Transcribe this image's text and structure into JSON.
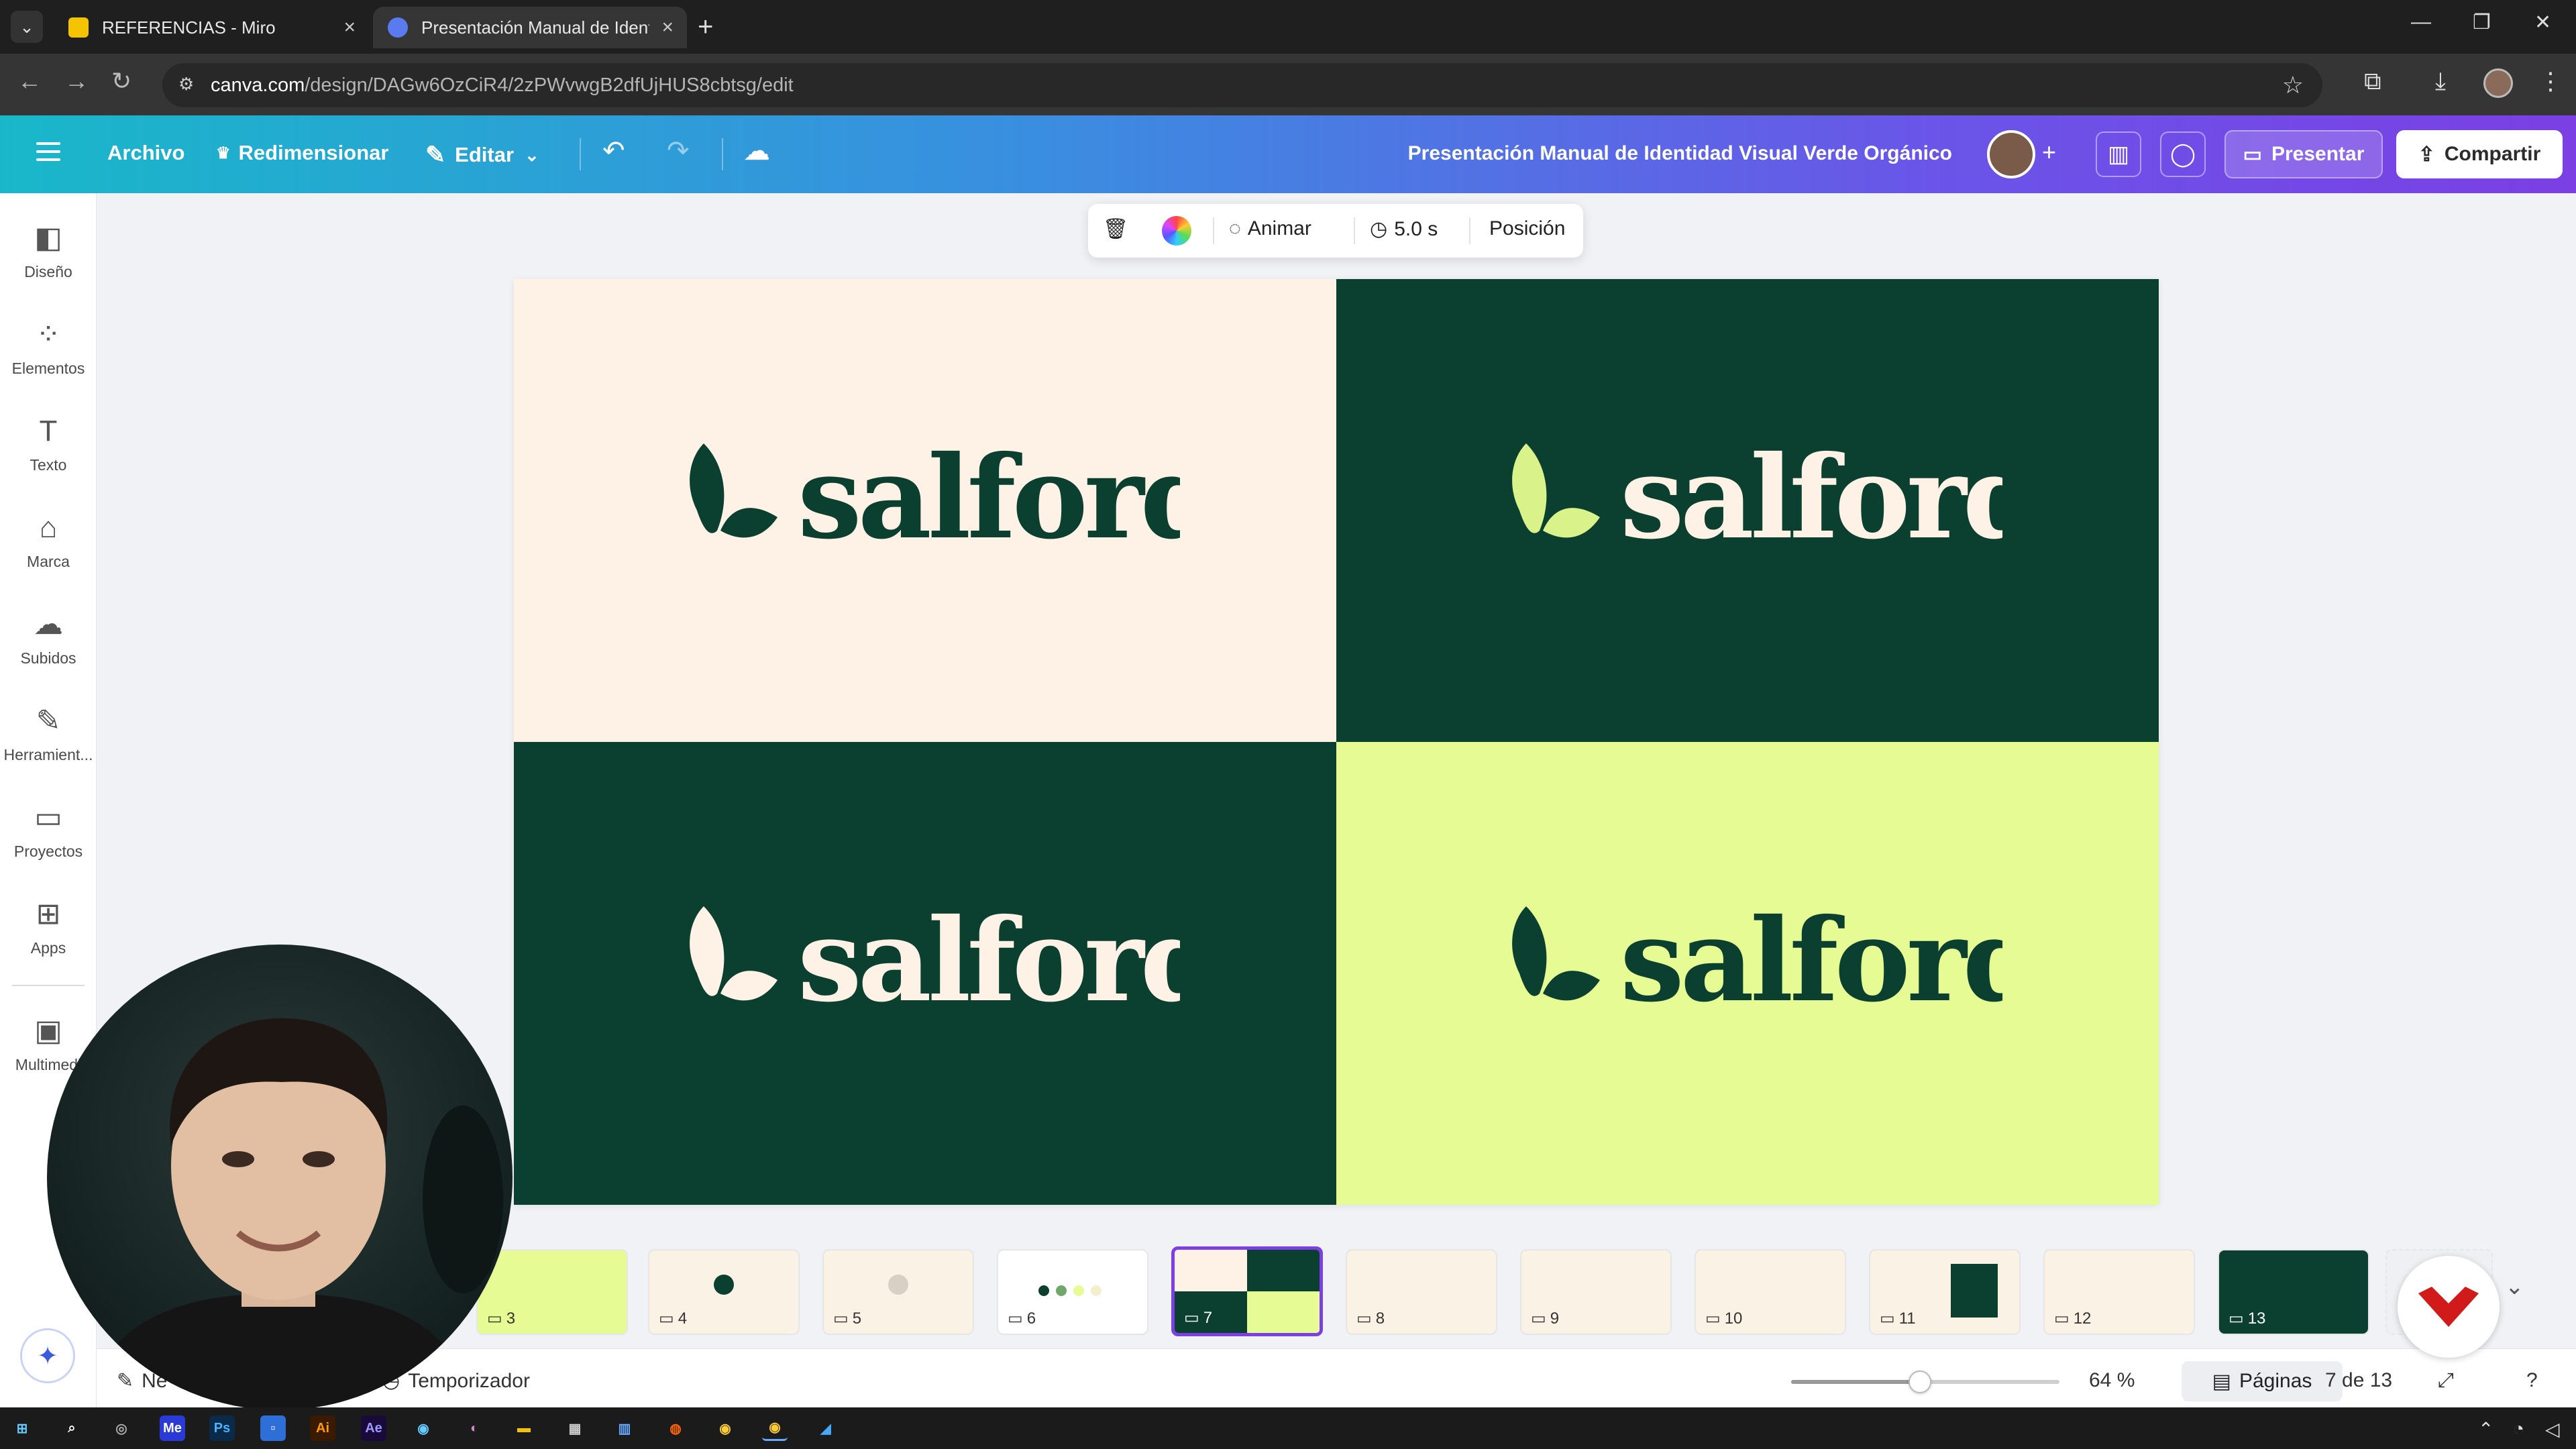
{
  "browser": {
    "tabs": [
      {
        "title": "REFERENCIAS - Miro",
        "active": false
      },
      {
        "title": "Presentación Manual de Identid",
        "active": true
      }
    ],
    "url_host": "canva.com",
    "url_path": "/design/DAGw6OzCiR4/2zPWvwgB2dfUjHUS8cbtsg/edit"
  },
  "header": {
    "file_label": "Archivo",
    "resize_label": "Redimensionar",
    "edit_label": "Editar",
    "doc_title": "Presentación Manual de Identidad Visual Verde Orgánico",
    "present_label": "Presentar",
    "share_label": "Compartir"
  },
  "sidebar": {
    "items": [
      {
        "label": "Diseño",
        "icon": "layout-icon"
      },
      {
        "label": "Elementos",
        "icon": "shapes-icon"
      },
      {
        "label": "Texto",
        "icon": "text-icon"
      },
      {
        "label": "Marca",
        "icon": "brand-icon"
      },
      {
        "label": "Subidos",
        "icon": "cloud-upload-icon"
      },
      {
        "label": "Herramient...",
        "icon": "pen-tool-icon"
      },
      {
        "label": "Proyectos",
        "icon": "folder-icon"
      },
      {
        "label": "Apps",
        "icon": "apps-grid-icon"
      },
      {
        "label": "Multimedi",
        "icon": "media-icon"
      }
    ]
  },
  "context_toolbar": {
    "animate_label": "Animar",
    "duration_label": "5.0 s",
    "position_label": "Posición"
  },
  "canvas": {
    "logo_text": "salford",
    "quadrants": [
      {
        "bg": "#fdf2e5",
        "text_color": "#0b4030",
        "leaf_light": "#0b4030",
        "leaf_dark": "#0b4030"
      },
      {
        "bg": "#0b4030",
        "text_color": "#fdf2e5",
        "leaf_light": "#d9f28a",
        "leaf_dark": "#d9f28a"
      },
      {
        "bg": "#0b4030",
        "text_color": "#fdf2e5",
        "leaf_light": "#fdf2e5",
        "leaf_dark": "#fdf2e5"
      },
      {
        "bg": "#e6fb93",
        "text_color": "#0b4030",
        "leaf_light": "#0b4030",
        "leaf_dark": "#0b4030"
      }
    ]
  },
  "thumbnails": [
    {
      "num": "3"
    },
    {
      "num": "4"
    },
    {
      "num": "5"
    },
    {
      "num": "6"
    },
    {
      "num": "7"
    },
    {
      "num": "8"
    },
    {
      "num": "9"
    },
    {
      "num": "10"
    },
    {
      "num": "11"
    },
    {
      "num": "12"
    },
    {
      "num": "13"
    }
  ],
  "bottombar": {
    "notes_label": "Ne",
    "timer_label": "Temporizador",
    "zoom_value": "64 %",
    "zoom_fraction": 0.48,
    "pages_label": "Páginas",
    "page_indicator": "7 de 13"
  },
  "colors": {
    "accent": "#7b3fe4",
    "brand_green": "#0b4030",
    "cream": "#fdf2e5",
    "lime": "#e6fb93"
  }
}
